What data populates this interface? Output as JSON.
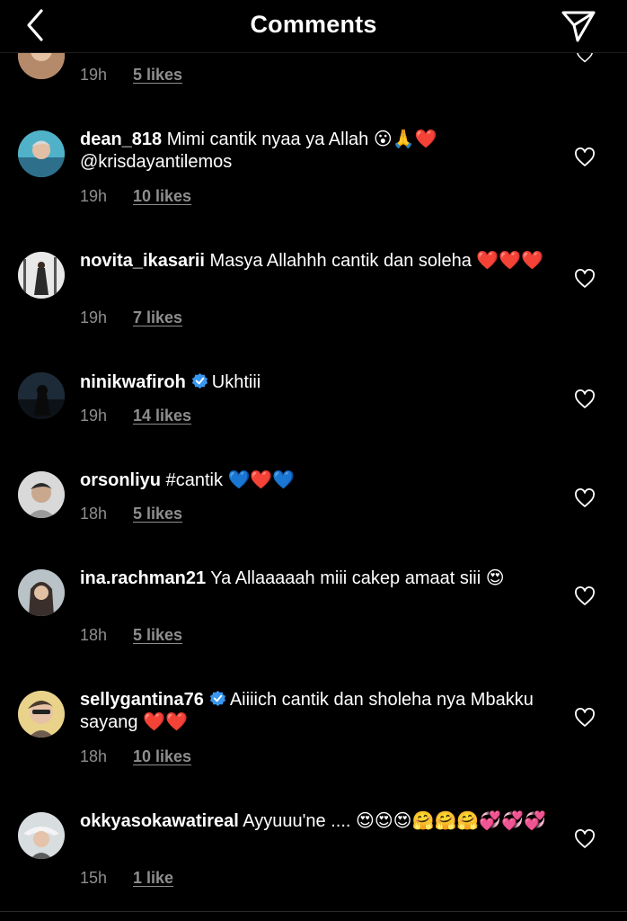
{
  "header": {
    "title": "Comments"
  },
  "top_partial": {
    "time": "19h",
    "likes": "5 likes"
  },
  "comments": [
    {
      "username": "dean_818",
      "verified": false,
      "text": "Mimi cantik nyaa ya Allah 😮🙏❤️ @krisdayantilemos",
      "time": "19h",
      "likes": "10 likes"
    },
    {
      "username": "novita_ikasarii",
      "verified": false,
      "text": "Masya Allahhh cantik dan soleha ❤️❤️❤️",
      "time": "19h",
      "likes": "7 likes"
    },
    {
      "username": "ninikwafiroh",
      "verified": true,
      "text": "Ukhtiii",
      "time": "19h",
      "likes": "14 likes"
    },
    {
      "username": "orsonliyu",
      "verified": false,
      "text": "#cantik 💙❤️💙",
      "time": "18h",
      "likes": "5 likes"
    },
    {
      "username": "ina.rachman21",
      "verified": false,
      "text": "Ya Allaaaaah miii cakep amaat siii 😍",
      "time": "18h",
      "likes": "5 likes"
    },
    {
      "username": "sellygantina76",
      "verified": true,
      "text": "Aiiiich cantik dan sholeha nya Mbakku sayang ❤️❤️",
      "time": "18h",
      "likes": "10 likes"
    },
    {
      "username": "okkyasokawatireal",
      "verified": false,
      "text": "Ayyuuu'ne .... 😍😍😍🤗🤗🤗💞💞💞",
      "time": "15h",
      "likes": "1 like"
    }
  ],
  "colors": {
    "background": "#000000",
    "text": "#ffffff",
    "muted": "#8e8e8e",
    "verified": "#3897f0"
  }
}
